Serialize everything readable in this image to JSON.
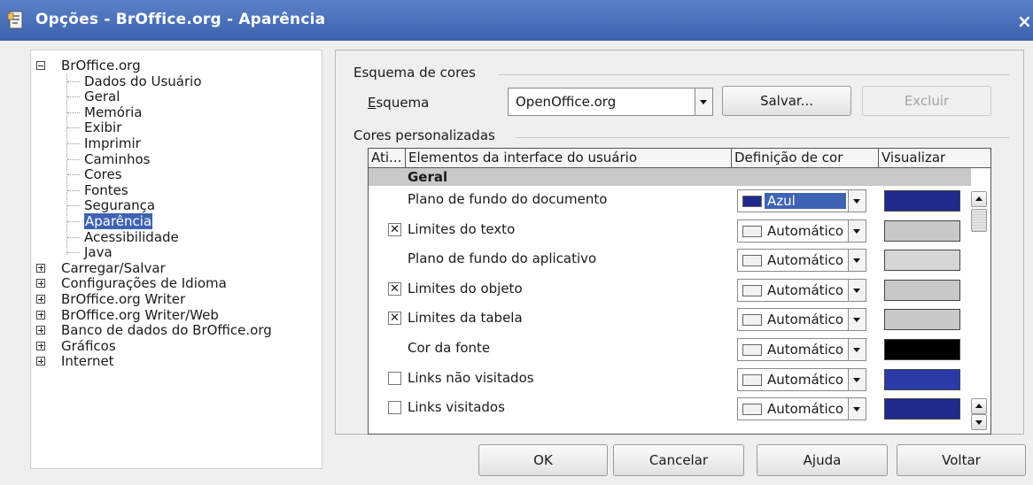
{
  "window": {
    "title": "Opções - BrOffice.org - Aparência",
    "close_label": "×"
  },
  "tree": {
    "root": "BrOffice.org",
    "children": [
      "Dados do Usuário",
      "Geral",
      "Memória",
      "Exibir",
      "Imprimir",
      "Caminhos",
      "Cores",
      "Fontes",
      "Segurança",
      "Aparência",
      "Acessibilidade",
      "Java"
    ],
    "collapsed": [
      "Carregar/Salvar",
      "Configurações de Idioma",
      "BrOffice.org Writer",
      "BrOffice.org Writer/Web",
      "Banco de dados do BrOffice.org",
      "Gráficos",
      "Internet"
    ],
    "selected": "Aparência"
  },
  "scheme": {
    "group_label": "Esquema de cores",
    "label": "Esquema",
    "value": "OpenOffice.org",
    "save_label": "Salvar...",
    "delete_label": "Excluir"
  },
  "custom": {
    "group_label": "Cores personalizadas",
    "columns": [
      "Ati...",
      "Elementos da interface do usuário",
      "Definição de cor",
      "Visualizar"
    ],
    "group_title": "Geral",
    "rows": [
      {
        "label": "Plano de fundo do documento",
        "checkbox": "none",
        "color_name": "Azul",
        "swatch": "#1f2a8c",
        "preview": "#1f2a8c"
      },
      {
        "label": "Limites do texto",
        "checkbox": "checked",
        "color_name": "Automático",
        "swatch": "#f2f2f2",
        "preview": "#c8c8c8"
      },
      {
        "label": "Plano de fundo do aplicativo",
        "checkbox": "none",
        "color_name": "Automático",
        "swatch": "#f2f2f2",
        "preview": "#d6d6d6"
      },
      {
        "label": "Limites do objeto",
        "checkbox": "checked",
        "color_name": "Automático",
        "swatch": "#f2f2f2",
        "preview": "#c8c8c8"
      },
      {
        "label": "Limites da tabela",
        "checkbox": "checked",
        "color_name": "Automático",
        "swatch": "#f2f2f2",
        "preview": "#c8c8c8"
      },
      {
        "label": "Cor da fonte",
        "checkbox": "none",
        "color_name": "Automático",
        "swatch": "#f2f2f2",
        "preview": "#000000"
      },
      {
        "label": "Links não visitados",
        "checkbox": "unchecked",
        "color_name": "Automático",
        "swatch": "#f2f2f2",
        "preview": "#2a3aa6"
      },
      {
        "label": "Links visitados",
        "checkbox": "unchecked",
        "color_name": "Automático",
        "swatch": "#f2f2f2",
        "preview": "#1f2a8c"
      }
    ]
  },
  "buttons": {
    "ok": "OK",
    "cancel": "Cancelar",
    "help": "Ajuda",
    "back": "Voltar"
  },
  "colors": {
    "titlebar": "#4a72bc",
    "selection": "#3f63b3"
  }
}
